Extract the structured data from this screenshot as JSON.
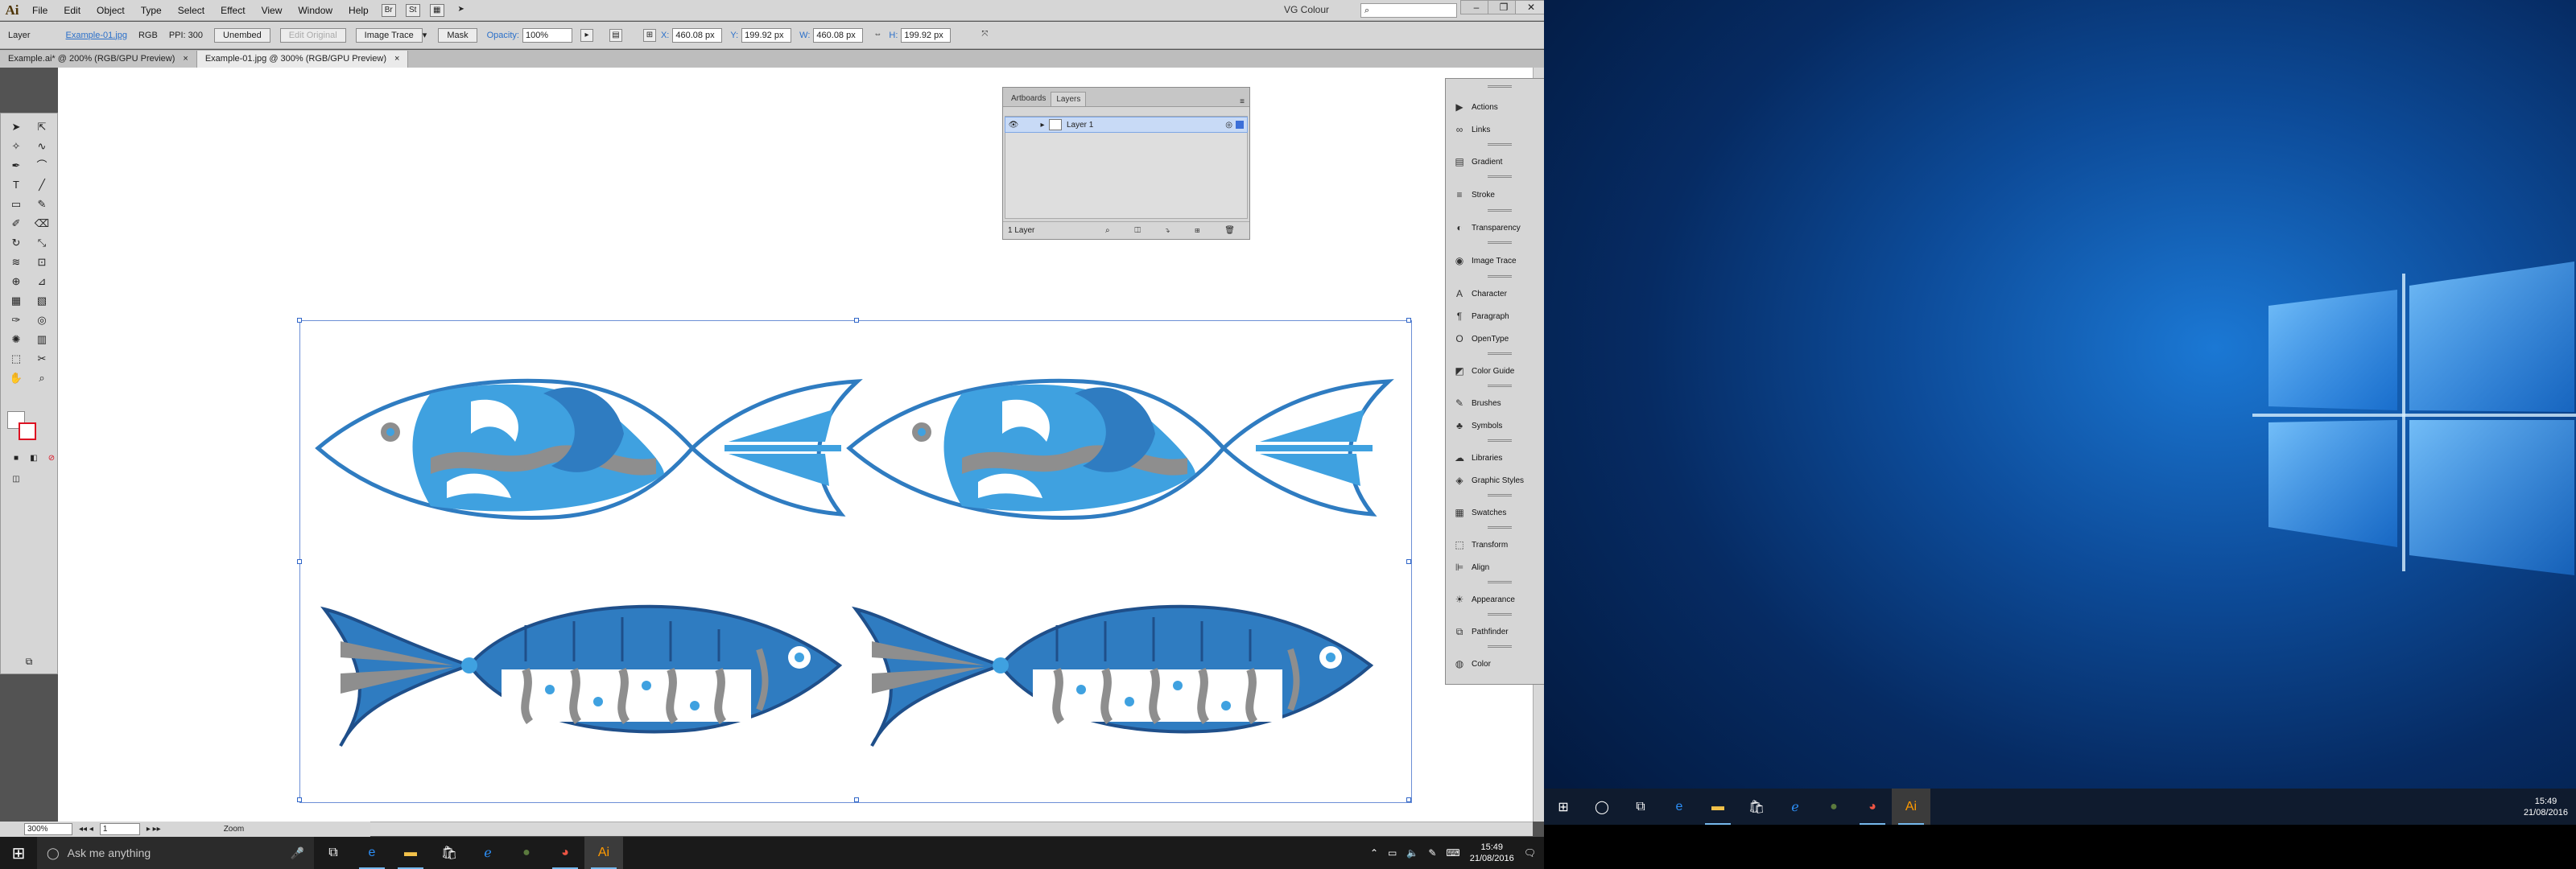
{
  "app": {
    "logo": "Ai"
  },
  "menu": [
    "File",
    "Edit",
    "Object",
    "Type",
    "Select",
    "Effect",
    "View",
    "Window",
    "Help"
  ],
  "workspace": "VG Colour",
  "search_placeholder": "",
  "control": {
    "layer": "Layer",
    "file": "Example-01.jpg",
    "color_mode": "RGB",
    "ppi": "PPI: 300",
    "embed": "Unembed",
    "edit_original": "Edit Original",
    "image_trace": "Image Trace",
    "mask": "Mask",
    "opacity_label": "Opacity:",
    "opacity": "100%",
    "x_label": "X:",
    "x": "460.08 px",
    "y_label": "Y:",
    "y": "199.92 px",
    "w_label": "W:",
    "w": "460.08 px",
    "h_label": "H:",
    "h": "199.92 px"
  },
  "tabs": [
    {
      "label": "Example.ai* @ 200% (RGB/GPU Preview)",
      "close": "×"
    },
    {
      "label": "Example-01.jpg @ 300% (RGB/GPU Preview)",
      "close": "×"
    }
  ],
  "status": {
    "zoom": "300%",
    "artboard": "1",
    "tool": "Zoom"
  },
  "layers_panel": {
    "tabs": [
      "Artboards",
      "Layers"
    ],
    "layer_name": "Layer 1",
    "count": "1 Layer"
  },
  "dock": [
    {
      "label": "Actions",
      "icon": "play-icon"
    },
    {
      "label": "Links",
      "icon": "link-icon"
    },
    {
      "label": "Gradient",
      "icon": "gradient-icon"
    },
    {
      "label": "Stroke",
      "icon": "stroke-icon"
    },
    {
      "label": "Transparency",
      "icon": "transparency-icon"
    },
    {
      "label": "Image Trace",
      "icon": "image-trace-icon"
    },
    {
      "label": "Character",
      "icon": "character-icon"
    },
    {
      "label": "Paragraph",
      "icon": "paragraph-icon"
    },
    {
      "label": "OpenType",
      "icon": "opentype-icon"
    },
    {
      "label": "Color Guide",
      "icon": "color-guide-icon"
    },
    {
      "label": "Brushes",
      "icon": "brushes-icon"
    },
    {
      "label": "Symbols",
      "icon": "symbols-icon"
    },
    {
      "label": "Libraries",
      "icon": "libraries-icon"
    },
    {
      "label": "Graphic Styles",
      "icon": "graphic-styles-icon"
    },
    {
      "label": "Swatches",
      "icon": "swatches-icon"
    },
    {
      "label": "Transform",
      "icon": "transform-icon"
    },
    {
      "label": "Align",
      "icon": "align-icon"
    },
    {
      "label": "Appearance",
      "icon": "appearance-icon"
    },
    {
      "label": "Pathfinder",
      "icon": "pathfinder-icon"
    },
    {
      "label": "Color",
      "icon": "color-icon"
    }
  ],
  "taskbar": {
    "cortana": "Ask me anything",
    "time": "15:49",
    "date": "21/08/2016"
  },
  "colors": {
    "fish_blue": "#2f7cc1",
    "fish_light": "#3fa1e0",
    "fish_gray": "#8e8e8e",
    "fish_dark": "#1f4f8a"
  }
}
